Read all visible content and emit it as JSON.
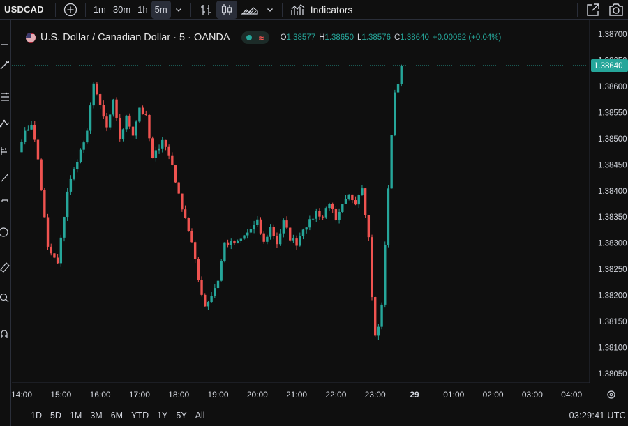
{
  "toolbar": {
    "symbol": "USDCAD",
    "intervals": [
      "1m",
      "30m",
      "1h",
      "5m"
    ],
    "active_interval": "5m",
    "indicators_label": "Indicators",
    "icons": [
      "add-symbol-icon",
      "chevron-down-icon",
      "bar-style-icon",
      "candlestick-icon",
      "area-chart-icon",
      "indicators-icon",
      "fullscreen-icon",
      "camera-icon"
    ]
  },
  "legend": {
    "title": "U.S. Dollar / Canadian Dollar · 5 · OANDA",
    "ohlc": {
      "o_label": "O",
      "o_value": "1.38577",
      "h_label": "H",
      "h_value": "1.38650",
      "l_label": "L",
      "l_value": "1.38576",
      "c_label": "C",
      "c_value": "1.38640",
      "change": "+0.00062 (+0.04%)"
    }
  },
  "price_scale": {
    "labels": [
      "1.38700",
      "1.38650",
      "1.38600",
      "1.38550",
      "1.38500",
      "1.38450",
      "1.38400",
      "1.38350",
      "1.38300",
      "1.38250",
      "1.38200",
      "1.38150",
      "1.38100",
      "1.38050"
    ],
    "current_price_label": "1.38640"
  },
  "time_scale": {
    "labels": [
      "14:00",
      "15:00",
      "16:00",
      "17:00",
      "18:00",
      "19:00",
      "20:00",
      "21:00",
      "22:00",
      "23:00",
      "29",
      "01:00",
      "02:00",
      "03:00",
      "04:00"
    ]
  },
  "bottom": {
    "ranges": [
      "1D",
      "5D",
      "1M",
      "3M",
      "6M",
      "YTD",
      "1Y",
      "5Y",
      "All"
    ],
    "clock": "03:29:41 UTC"
  },
  "colors": {
    "background": "#0f0f0f",
    "up": "#26a69a",
    "down": "#ef5350",
    "text": "#d1d4dc",
    "grid": "#2a2e39"
  },
  "chart_data": {
    "type": "candlestick",
    "title": "U.S. Dollar / Canadian Dollar · 5 · OANDA",
    "interval": "5m",
    "ylim": [
      1.3803,
      1.3873
    ],
    "x_ticks": [
      "14:00",
      "15:00",
      "16:00",
      "17:00",
      "18:00",
      "19:00",
      "20:00",
      "21:00",
      "22:00",
      "23:00",
      "29",
      "01:00",
      "02:00",
      "03:00",
      "04:00"
    ],
    "last_close": 1.3864,
    "path": [
      [
        0,
        1.385
      ],
      [
        3,
        1.3853
      ],
      [
        5,
        1.3846
      ],
      [
        8,
        1.3829
      ],
      [
        11,
        1.3826
      ],
      [
        14,
        1.384
      ],
      [
        17,
        1.3846
      ],
      [
        20,
        1.3851
      ],
      [
        22,
        1.3861
      ],
      [
        24,
        1.3856
      ],
      [
        26,
        1.3852
      ],
      [
        28,
        1.3857
      ],
      [
        30,
        1.385
      ],
      [
        32,
        1.3854
      ],
      [
        34,
        1.3851
      ],
      [
        36,
        1.3856
      ],
      [
        38,
        1.3854
      ],
      [
        40,
        1.3846
      ],
      [
        43,
        1.385
      ],
      [
        46,
        1.3845
      ],
      [
        48,
        1.3839
      ],
      [
        50,
        1.3835
      ],
      [
        52,
        1.383
      ],
      [
        54,
        1.3823
      ],
      [
        56,
        1.3818
      ],
      [
        58,
        1.382
      ],
      [
        60,
        1.3823
      ],
      [
        62,
        1.383
      ],
      [
        64,
        1.383
      ],
      [
        66,
        1.383
      ],
      [
        69,
        1.3832
      ],
      [
        72,
        1.3834
      ],
      [
        74,
        1.383
      ],
      [
        76,
        1.3833
      ],
      [
        78,
        1.383
      ],
      [
        80,
        1.3834
      ],
      [
        82,
        1.3831
      ],
      [
        84,
        1.383
      ],
      [
        86,
        1.3833
      ],
      [
        88,
        1.3834
      ],
      [
        90,
        1.3836
      ],
      [
        92,
        1.3835
      ],
      [
        94,
        1.3838
      ],
      [
        96,
        1.3834
      ],
      [
        98,
        1.3837
      ],
      [
        100,
        1.3839
      ],
      [
        102,
        1.3838
      ],
      [
        104,
        1.3841
      ],
      [
        106,
        1.3831
      ],
      [
        107,
        1.382
      ],
      [
        108,
        1.3812
      ],
      [
        109,
        1.3814
      ],
      [
        110,
        1.3818
      ],
      [
        111,
        1.383
      ],
      [
        112,
        1.384
      ],
      [
        113,
        1.3851
      ],
      [
        114,
        1.3859
      ],
      [
        115,
        1.386
      ],
      [
        116,
        1.3864
      ]
    ]
  }
}
